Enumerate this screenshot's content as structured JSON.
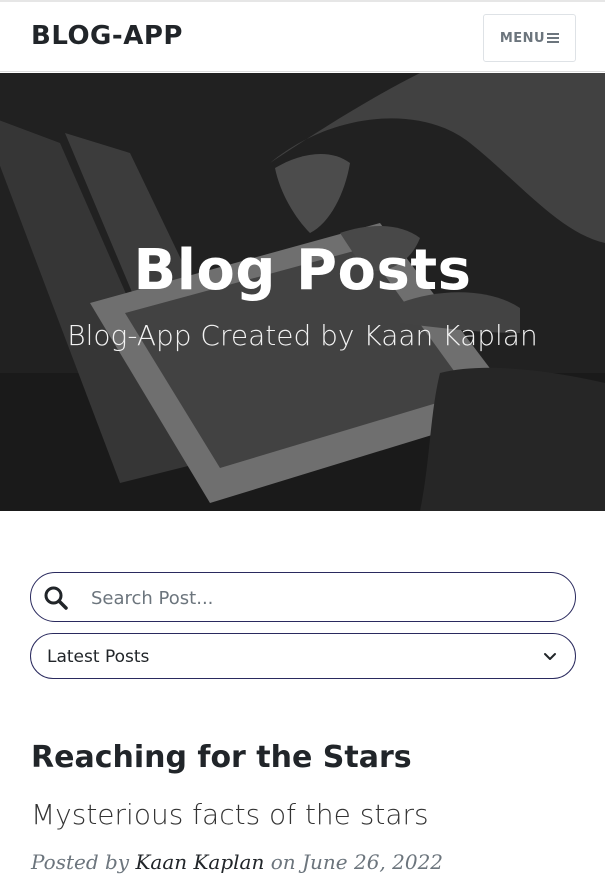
{
  "navbar": {
    "brand": "BLOG-APP",
    "menu_label": "MENU"
  },
  "hero": {
    "title": "Blog Posts",
    "subtitle": "Blog-App Created by Kaan Kaplan"
  },
  "search": {
    "placeholder": "Search Post..."
  },
  "filter": {
    "selected": "Latest Posts"
  },
  "post": {
    "title": "Reaching for the Stars",
    "subtitle": "Mysterious facts of the stars",
    "posted_by_label": "Posted by",
    "author": "Kaan Kaplan",
    "date_prefix": "on",
    "date": "June 26, 2022"
  },
  "colors": {
    "input_border": "#2a2a5e",
    "text": "#212529",
    "muted": "#6c757d"
  },
  "icons": {
    "menu": "hamburger-icon",
    "search": "search-icon",
    "dropdown": "chevron-down-icon"
  }
}
